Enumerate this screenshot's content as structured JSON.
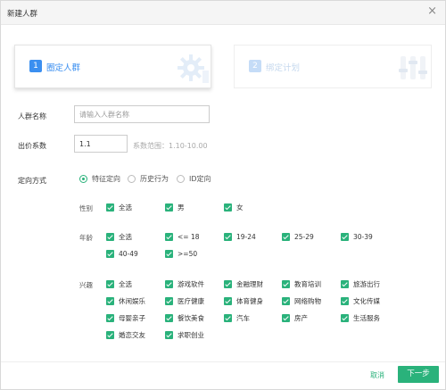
{
  "dialog": {
    "title": "新建人群",
    "close_glyph": "×"
  },
  "steps": [
    {
      "num": "1",
      "label": "圈定人群",
      "state": "active"
    },
    {
      "num": "2",
      "label": "绑定计划",
      "state": "inactive"
    }
  ],
  "form": {
    "name_label": "人群名称",
    "name_placeholder": "请输入人群名称",
    "name_value": "",
    "bid_label": "出价系数",
    "bid_value": "1.1",
    "bid_hint": "系数范围：1.10-10.00",
    "targeting_label": "定向方式",
    "targeting_options": [
      "特征定向",
      "历史行为",
      "ID定向"
    ],
    "targeting_selected": "特征定向"
  },
  "groups": {
    "gender": {
      "label": "性别",
      "options": [
        "全选",
        "男",
        "女"
      ]
    },
    "age": {
      "label": "年龄",
      "options": [
        "全选",
        "<= 18",
        "19-24",
        "25-29",
        "30-39",
        "40-49",
        ">=50"
      ]
    },
    "interest": {
      "label": "兴趣",
      "options": [
        "全选",
        "游戏软件",
        "金融理财",
        "教育培训",
        "旅游出行",
        "休闲娱乐",
        "医疗健康",
        "体育健身",
        "网络购物",
        "文化传媒",
        "母婴亲子",
        "餐饮美食",
        "汽车",
        "房产",
        "生活服务",
        "婚恋交友",
        "求职创业"
      ]
    }
  },
  "footer": {
    "cancel_label": "取消",
    "next_label": "下一步"
  },
  "colors": {
    "accent": "#2ab27b",
    "step_active": "#3b8ff0",
    "step_inactive": "#c5dcf7"
  },
  "icons": {
    "step1": "gear-icon",
    "step2": "sliders-icon",
    "check": "check-icon"
  }
}
